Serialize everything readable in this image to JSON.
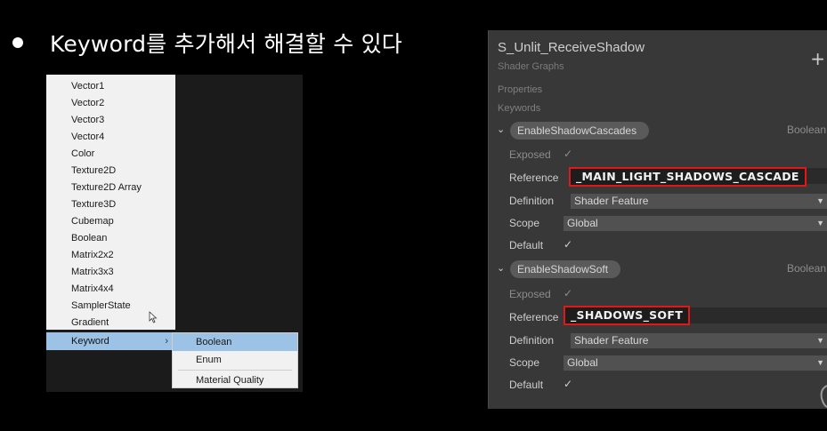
{
  "slide": {
    "title": "Keyword를 추가해서 해결할 수 있다"
  },
  "menu": {
    "items": [
      "Vector1",
      "Vector2",
      "Vector3",
      "Vector4",
      "Color",
      "Texture2D",
      "Texture2D Array",
      "Texture3D",
      "Cubemap",
      "Boolean",
      "Matrix2x2",
      "Matrix3x3",
      "Matrix4x4",
      "SamplerState",
      "Gradient"
    ],
    "keyword_label": "Keyword",
    "keyword_arrow": "›",
    "submenu": [
      "Boolean",
      "Enum",
      "Material Quality"
    ]
  },
  "shader_graph": {
    "title": "S_Unlit_ReceiveShadow",
    "subtitle": "Shader Graphs",
    "plus": "+",
    "properties_label": "Properties",
    "keywords_label": "Keywords",
    "keywords": [
      {
        "name": "EnableShadowCascades",
        "type": "Boolean",
        "exposed_label": "Exposed",
        "reference_label": "Reference",
        "reference_value": "_MAIN_LIGHT_SHADOWS_CASCADE",
        "definition_label": "Definition",
        "definition_value": "Shader Feature",
        "scope_label": "Scope",
        "scope_value": "Global",
        "default_label": "Default"
      },
      {
        "name": "EnableShadowSoft",
        "type": "Boolean",
        "exposed_label": "Exposed",
        "reference_label": "Reference",
        "reference_value": "_SHADOWS_SOFT",
        "definition_label": "Definition",
        "definition_value": "Shader Feature",
        "scope_label": "Scope",
        "scope_value": "Global",
        "default_label": "Default"
      }
    ]
  },
  "icons": {
    "check": "✓",
    "chevron": "⌄",
    "caret": "▼"
  },
  "colors": {
    "highlight_blue": "#9cc3e6",
    "annotation_red": "#e01818",
    "panel_bg": "#383838"
  }
}
